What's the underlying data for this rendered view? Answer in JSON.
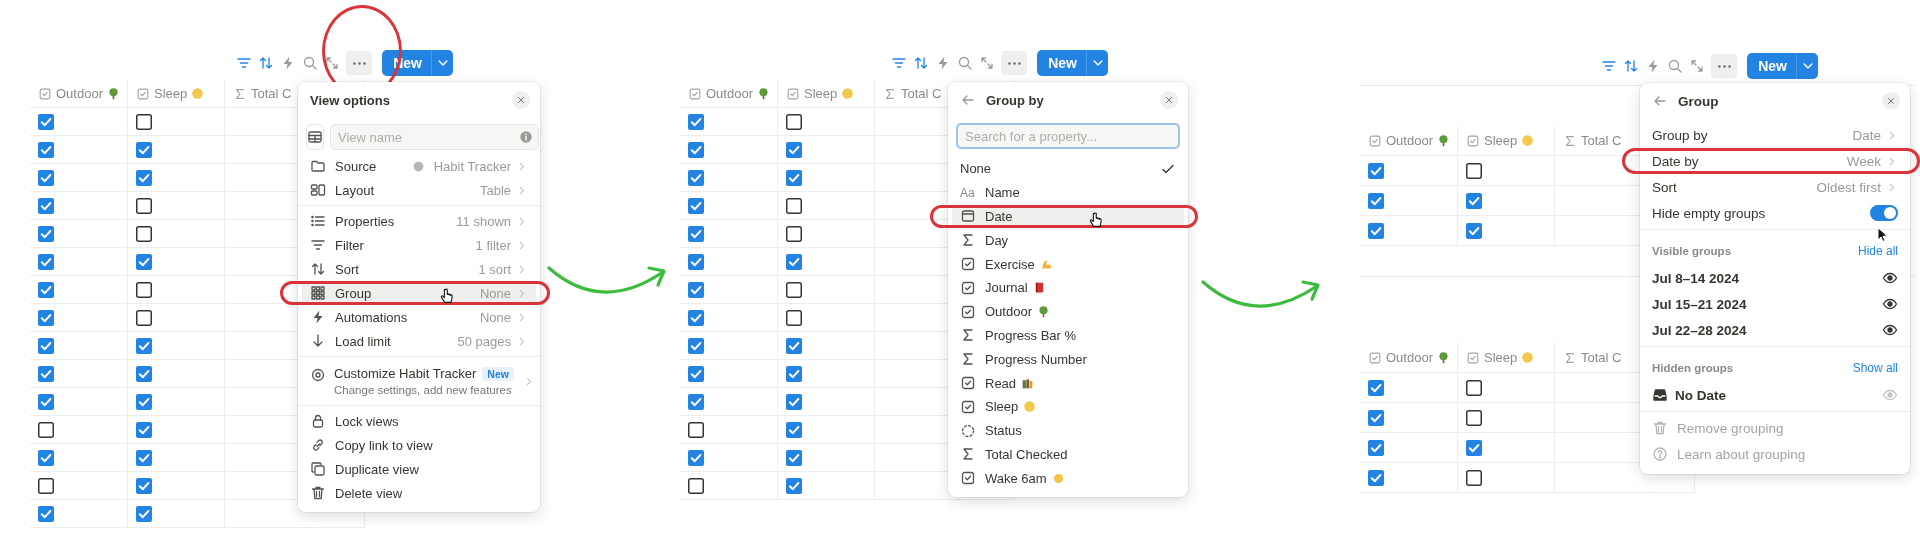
{
  "panels": [
    {
      "toolbar": {
        "tools": [
          {
            "active": true
          },
          {
            "active": true
          },
          {
            "active": false
          },
          {
            "active": false
          },
          {
            "active": false
          }
        ],
        "more_circled": true,
        "new_label": "New"
      },
      "tables": [
        {
          "columns": [
            {
              "kind": "checkbox",
              "label": "Outdoor"
            },
            {
              "kind": "checkbox",
              "label": "Sleep"
            },
            {
              "kind": "formula",
              "label": "Total C"
            }
          ],
          "rows": [
            {
              "cells": [
                {
                  "checked": true
                },
                {
                  "checked": false
                }
              ]
            },
            {
              "cells": [
                {
                  "checked": true
                },
                {
                  "checked": true
                }
              ]
            },
            {
              "cells": [
                {
                  "checked": true
                },
                {
                  "checked": true
                }
              ]
            },
            {
              "cells": [
                {
                  "checked": true
                },
                {
                  "checked": false
                }
              ]
            },
            {
              "cells": [
                {
                  "checked": true
                },
                {
                  "checked": false
                }
              ]
            },
            {
              "cells": [
                {
                  "checked": true
                },
                {
                  "checked": true
                }
              ]
            },
            {
              "cells": [
                {
                  "checked": true
                },
                {
                  "checked": false
                }
              ]
            },
            {
              "cells": [
                {
                  "checked": true
                },
                {
                  "checked": false
                }
              ]
            },
            {
              "cells": [
                {
                  "checked": true
                },
                {
                  "checked": true
                }
              ]
            },
            {
              "cells": [
                {
                  "checked": true
                },
                {
                  "checked": true
                }
              ]
            },
            {
              "cells": [
                {
                  "checked": true
                },
                {
                  "checked": true
                }
              ]
            },
            {
              "cells": [
                {
                  "checked": false
                },
                {
                  "checked": true
                }
              ]
            },
            {
              "cells": [
                {
                  "checked": true
                },
                {
                  "checked": true
                }
              ]
            },
            {
              "cells": [
                {
                  "checked": false
                },
                {
                  "checked": true
                }
              ]
            },
            {
              "cells": [
                {
                  "checked": true
                },
                {
                  "checked": true
                }
              ]
            }
          ]
        }
      ],
      "menu": {
        "title": "View options",
        "back": false,
        "close": true,
        "sections": [
          {
            "items": [
              {
                "kind": "name_field",
                "placeholder": "View name"
              },
              {
                "kind": "row",
                "label": "Source",
                "value": "Habit Tracker",
                "hovered": false,
                "circled": false
              },
              {
                "kind": "row",
                "label": "Layout",
                "value": "Table",
                "hovered": false,
                "circled": false
              }
            ]
          },
          {
            "items": [
              {
                "kind": "row",
                "label": "Properties",
                "value": "11 shown",
                "hovered": false,
                "circled": false
              },
              {
                "kind": "row",
                "label": "Filter",
                "value": "1 filter",
                "hovered": false,
                "circled": false
              },
              {
                "kind": "row",
                "label": "Sort",
                "value": "1 sort",
                "hovered": false,
                "circled": false
              },
              {
                "kind": "row",
                "label": "Group",
                "value": "None",
                "hovered": true,
                "circled": true
              },
              {
                "kind": "row",
                "label": "Automations",
                "value": "None",
                "hovered": false,
                "circled": false
              },
              {
                "kind": "row",
                "label": "Load limit",
                "value": "50 pages",
                "hovered": false,
                "circled": false
              }
            ]
          },
          {
            "items": [
              {
                "kind": "promo",
                "label": "Customize Habit Tracker",
                "badge": "New",
                "description": "Change settings, add new features"
              }
            ]
          },
          {
            "items": [
              {
                "kind": "row",
                "label": "Lock views",
                "hovered": false,
                "circled": false
              },
              {
                "kind": "row",
                "label": "Copy link to view",
                "hovered": false,
                "circled": false
              },
              {
                "kind": "row",
                "label": "Duplicate view",
                "hovered": false,
                "circled": false
              },
              {
                "kind": "row",
                "label": "Delete view",
                "hovered": false,
                "circled": false
              }
            ]
          }
        ]
      }
    },
    {
      "toolbar": {
        "tools": [
          {
            "active": true
          },
          {
            "active": true
          },
          {
            "active": false
          },
          {
            "active": false
          },
          {
            "active": false
          }
        ],
        "more_circled": false,
        "new_label": "New"
      },
      "tables": [
        {
          "columns": [
            {
              "kind": "checkbox",
              "label": "Outdoor"
            },
            {
              "kind": "checkbox",
              "label": "Sleep"
            },
            {
              "kind": "formula",
              "label": "Total C"
            }
          ],
          "rows": [
            {
              "cells": [
                {
                  "checked": true
                },
                {
                  "checked": false
                }
              ]
            },
            {
              "cells": [
                {
                  "checked": true
                },
                {
                  "checked": true
                }
              ]
            },
            {
              "cells": [
                {
                  "checked": true
                },
                {
                  "checked": true
                }
              ]
            },
            {
              "cells": [
                {
                  "checked": true
                },
                {
                  "checked": false
                }
              ]
            },
            {
              "cells": [
                {
                  "checked": true
                },
                {
                  "checked": false
                }
              ]
            },
            {
              "cells": [
                {
                  "checked": true
                },
                {
                  "checked": true
                }
              ]
            },
            {
              "cells": [
                {
                  "checked": true
                },
                {
                  "checked": false
                }
              ]
            },
            {
              "cells": [
                {
                  "checked": true
                },
                {
                  "checked": false
                }
              ]
            },
            {
              "cells": [
                {
                  "checked": true
                },
                {
                  "checked": true
                }
              ]
            },
            {
              "cells": [
                {
                  "checked": true
                },
                {
                  "checked": true
                }
              ]
            },
            {
              "cells": [
                {
                  "checked": true
                },
                {
                  "checked": true
                }
              ]
            },
            {
              "cells": [
                {
                  "checked": false
                },
                {
                  "checked": true
                }
              ]
            },
            {
              "cells": [
                {
                  "checked": true
                },
                {
                  "checked": true
                }
              ]
            },
            {
              "cells": [
                {
                  "checked": false
                },
                {
                  "checked": true
                }
              ]
            }
          ]
        }
      ],
      "menu": {
        "title": "Group by",
        "back": true,
        "close": true,
        "sections": [
          {
            "items": [
              {
                "kind": "search",
                "placeholder": "Search for a property...",
                "focused": true
              },
              {
                "kind": "plain_option",
                "label": "None",
                "selected": true,
                "hovered": false,
                "circled": false
              },
              {
                "kind": "title_option",
                "type_text": "Aa",
                "label": "Name",
                "selected": false,
                "hovered": false,
                "circled": false
              },
              {
                "kind": "date_option",
                "label": "Date",
                "selected": false,
                "hovered": true,
                "circled": true
              },
              {
                "kind": "formula_option",
                "label": "Day",
                "selected": false,
                "hovered": false,
                "circled": false
              },
              {
                "kind": "checkbox_option",
                "label": "Exercise",
                "selected": false,
                "hovered": false,
                "circled": false
              },
              {
                "kind": "checkbox_option",
                "label": "Journal",
                "selected": false,
                "hovered": false,
                "circled": false
              },
              {
                "kind": "checkbox_option",
                "label": "Outdoor",
                "selected": false,
                "hovered": false,
                "circled": false
              },
              {
                "kind": "formula_option",
                "label": "Progress Bar %",
                "selected": false,
                "hovered": false,
                "circled": false
              },
              {
                "kind": "formula_option",
                "label": "Progress Number",
                "selected": false,
                "hovered": false,
                "circled": false
              },
              {
                "kind": "checkbox_option",
                "label": "Read",
                "selected": false,
                "hovered": false,
                "circled": false
              },
              {
                "kind": "checkbox_option",
                "label": "Sleep",
                "selected": false,
                "hovered": false,
                "circled": false
              },
              {
                "kind": "status_option",
                "label": "Status",
                "selected": false,
                "hovered": false,
                "circled": false
              },
              {
                "kind": "formula_option",
                "label": "Total Checked",
                "selected": false,
                "hovered": false,
                "circled": false
              },
              {
                "kind": "checkbox_option",
                "label": "Wake 6am",
                "selected": false,
                "hovered": false,
                "circled": false
              }
            ]
          }
        ]
      }
    },
    {
      "toolbar": {
        "tools": [
          {
            "active": true
          },
          {
            "active": true
          },
          {
            "active": false
          },
          {
            "active": false
          },
          {
            "active": false
          }
        ],
        "more_circled": false,
        "new_label": "New"
      },
      "tables": [
        {
          "columns": [
            {
              "kind": "checkbox",
              "label": "Outdoor"
            },
            {
              "kind": "checkbox",
              "label": "Sleep"
            },
            {
              "kind": "formula",
              "label": "Total C"
            }
          ],
          "rows": [
            {
              "cells": [
                {
                  "checked": true
                },
                {
                  "checked": false
                }
              ]
            },
            {
              "cells": [
                {
                  "checked": true
                },
                {
                  "checked": true
                }
              ]
            },
            {
              "cells": [
                {
                  "checked": true
                },
                {
                  "checked": true
                }
              ]
            }
          ]
        },
        {
          "columns": [
            {
              "kind": "checkbox",
              "label": "Outdoor"
            },
            {
              "kind": "checkbox",
              "label": "Sleep"
            },
            {
              "kind": "formula",
              "label": "Total C"
            }
          ],
          "rows": [
            {
              "cells": [
                {
                  "checked": true
                },
                {
                  "checked": false
                }
              ]
            },
            {
              "cells": [
                {
                  "checked": true
                },
                {
                  "checked": false
                }
              ]
            },
            {
              "cells": [
                {
                  "checked": true
                },
                {
                  "checked": true
                }
              ]
            },
            {
              "cells": [
                {
                  "checked": true
                },
                {
                  "checked": false
                }
              ]
            }
          ]
        }
      ],
      "menu": {
        "title": "Group",
        "back": true,
        "close": true,
        "sections": [
          {
            "items": [
              {
                "kind": "row",
                "label": "Group by",
                "value": "Date",
                "hovered": false,
                "circled": false
              },
              {
                "kind": "row",
                "label": "Date by",
                "value": "Week",
                "hovered": false,
                "circled": true
              },
              {
                "kind": "row",
                "label": "Sort",
                "value": "Oldest first",
                "hovered": false,
                "circled": false
              },
              {
                "kind": "toggle",
                "label": "Hide empty groups",
                "on": true
              }
            ]
          },
          {
            "items": [
              {
                "kind": "heading",
                "label": "Visible groups",
                "action": "Hide all"
              },
              {
                "kind": "group",
                "label": "Jul 8–14 2024",
                "visible": true
              },
              {
                "kind": "group",
                "label": "Jul 15–21 2024",
                "visible": true
              },
              {
                "kind": "group",
                "label": "Jul 22–28 2024",
                "visible": true
              }
            ]
          },
          {
            "items": [
              {
                "kind": "heading",
                "label": "Hidden groups",
                "action": "Show all"
              },
              {
                "kind": "group",
                "label": "No Date",
                "visible": false
              }
            ]
          },
          {
            "items": [
              {
                "kind": "action",
                "label": "Remove grouping",
                "disabled": true
              },
              {
                "kind": "action",
                "label": "Learn about grouping",
                "disabled": true
              }
            ]
          }
        ]
      }
    }
  ]
}
